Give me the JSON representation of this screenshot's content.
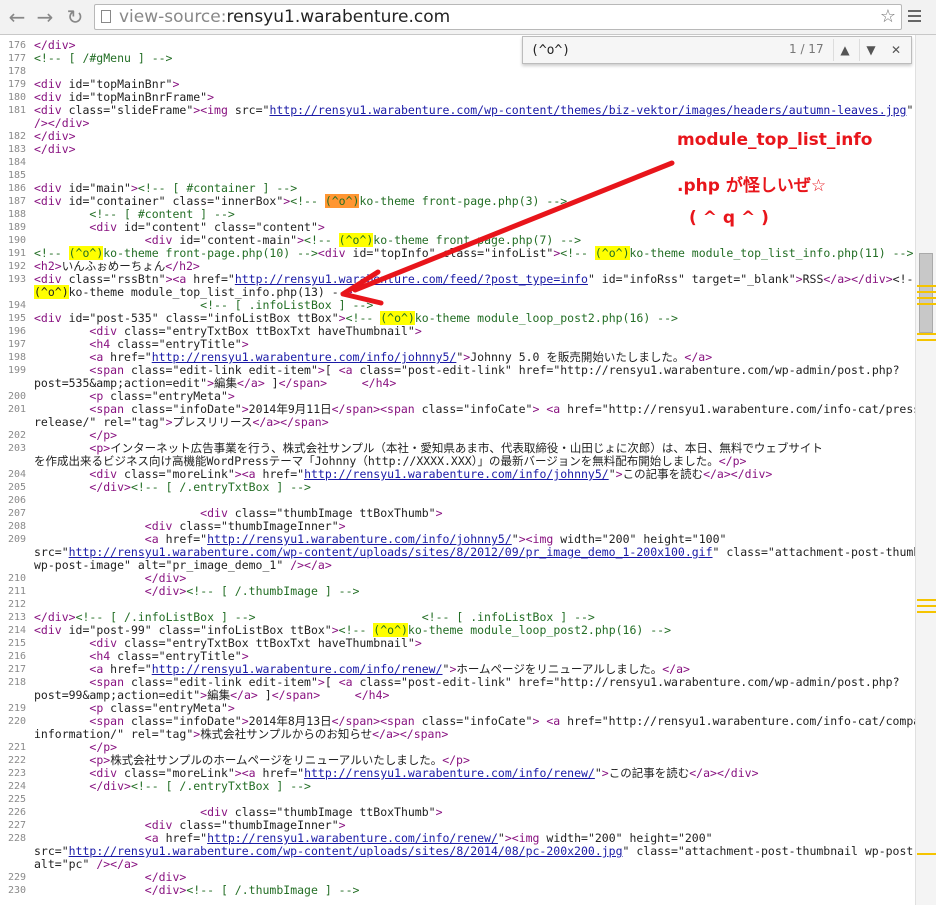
{
  "browser": {
    "url_scheme": "view-source:",
    "url_host": "rensyu1.warabenture.com"
  },
  "find_bar": {
    "query": "(^o^)",
    "count": "1 / 17"
  },
  "annotation": {
    "line1": "module_top_list_info",
    "line2": ".php が怪しいぜ☆",
    "line3": "( ^ q ^ )",
    "color": "#e8151b"
  },
  "source_lines": [
    {
      "n": "176",
      "text": "</div>"
    },
    {
      "n": "177",
      "text": "<!-- [ /#gMenu ] -->"
    },
    {
      "n": "178",
      "text": ""
    },
    {
      "n": "179",
      "text": "<div id=\"topMainBnr\">"
    },
    {
      "n": "180",
      "text": "<div id=\"topMainBnrFrame\">"
    },
    {
      "n": "181",
      "text": "<div class=\"slideFrame\"><img src=\"http://rensyu1.warabenture.com/wp-content/themes/biz-vektor/images/headers/autumn-leaves.jpg\" alt=\"\""
    },
    {
      "n": "",
      "text": "/></div>"
    },
    {
      "n": "182",
      "text": "</div>"
    },
    {
      "n": "183",
      "text": "</div>"
    },
    {
      "n": "184",
      "text": ""
    },
    {
      "n": "185",
      "text": ""
    },
    {
      "n": "186",
      "text": "<div id=\"main\"><!-- [ #container ] -->"
    },
    {
      "n": "187",
      "text": "<div id=\"container\" class=\"innerBox\"><!-- (^o^)ko-theme front-page.php(3) -->"
    },
    {
      "n": "188",
      "text": "        <!-- [ #content ] -->"
    },
    {
      "n": "189",
      "text": "        <div id=\"content\" class=\"content\">"
    },
    {
      "n": "190",
      "text": "                <div id=\"content-main\"><!-- (^o^)ko-theme front-page.php(7) -->"
    },
    {
      "n": "191",
      "text": "<!-- (^o^)ko-theme front-page.php(10) --><div id=\"topInfo\" class=\"infoList\"><!-- (^o^)ko-theme module_top_list_info.php(11) -->"
    },
    {
      "n": "192",
      "text": "<h2>いんふぉめーちょん</h2>"
    },
    {
      "n": "193",
      "text": "<div class=\"rssBtn\"><a href=\"http://rensyu1.warabenture.com/feed/?post_type=info\" id=\"infoRss\" target=\"_blank\">RSS</a></div><!--"
    },
    {
      "n": "",
      "text": "(^o^)ko-theme module_top_list_info.php(13) -->"
    },
    {
      "n": "194",
      "text": "                        <!-- [ .infoListBox ] -->"
    },
    {
      "n": "195",
      "text": "<div id=\"post-535\" class=\"infoListBox ttBox\"><!-- (^o^)ko-theme module_loop_post2.php(16) -->"
    },
    {
      "n": "196",
      "text": "        <div class=\"entryTxtBox ttBoxTxt haveThumbnail\">"
    },
    {
      "n": "197",
      "text": "        <h4 class=\"entryTitle\">"
    },
    {
      "n": "198",
      "text": "        <a href=\"http://rensyu1.warabenture.com/info/johnny5/\">Johnny 5.0 を販売開始いたしました。</a>"
    },
    {
      "n": "199",
      "text": "        <span class=\"edit-link edit-item\">[ <a class=\"post-edit-link\" href=\"http://rensyu1.warabenture.com/wp-admin/post.php?"
    },
    {
      "n": "",
      "text": "post=535&amp;action=edit\">編集</a> ]</span>     </h4>"
    },
    {
      "n": "200",
      "text": "        <p class=\"entryMeta\">"
    },
    {
      "n": "201",
      "text": "        <span class=\"infoDate\">2014年9月11日</span><span class=\"infoCate\"> <a href=\"http://rensyu1.warabenture.com/info-cat/press-"
    },
    {
      "n": "",
      "text": "release/\" rel=\"tag\">プレスリリース</a></span>"
    },
    {
      "n": "202",
      "text": "        </p>"
    },
    {
      "n": "203",
      "text": "        <p>インターネット広告事業を行う、株式会社サンプル（本社・愛知県あま市、代表取締役・山田じょに次郎）は、本日、無料でウェブサイト"
    },
    {
      "n": "",
      "text": "を作成出来るビジネス向け高機能WordPressテーマ「Johnny（http://XXXX.XXX）」の最新バージョンを無料配布開始しました。</p>"
    },
    {
      "n": "204",
      "text": "        <div class=\"moreLink\"><a href=\"http://rensyu1.warabenture.com/info/johnny5/\">この記事を読む</a></div>"
    },
    {
      "n": "205",
      "text": "        </div><!-- [ /.entryTxtBox ] -->"
    },
    {
      "n": "206",
      "text": ""
    },
    {
      "n": "207",
      "text": "                        <div class=\"thumbImage ttBoxThumb\">"
    },
    {
      "n": "208",
      "text": "                <div class=\"thumbImageInner\">"
    },
    {
      "n": "209",
      "text": "                <a href=\"http://rensyu1.warabenture.com/info/johnny5/\"><img width=\"200\" height=\"100\""
    },
    {
      "n": "",
      "text": "src=\"http://rensyu1.warabenture.com/wp-content/uploads/sites/8/2012/09/pr_image_demo_1-200x100.gif\" class=\"attachment-post-thumbnail"
    },
    {
      "n": "",
      "text": "wp-post-image\" alt=\"pr_image_demo_1\" /></a>"
    },
    {
      "n": "210",
      "text": "                </div>"
    },
    {
      "n": "211",
      "text": "                </div><!-- [ /.thumbImage ] -->"
    },
    {
      "n": "212",
      "text": ""
    },
    {
      "n": "213",
      "text": "</div><!-- [ /.infoListBox ] -->                        <!-- [ .infoListBox ] -->"
    },
    {
      "n": "214",
      "text": "<div id=\"post-99\" class=\"infoListBox ttBox\"><!-- (^o^)ko-theme module_loop_post2.php(16) -->"
    },
    {
      "n": "215",
      "text": "        <div class=\"entryTxtBox ttBoxTxt haveThumbnail\">"
    },
    {
      "n": "216",
      "text": "        <h4 class=\"entryTitle\">"
    },
    {
      "n": "217",
      "text": "        <a href=\"http://rensyu1.warabenture.com/info/renew/\">ホームページをリニューアルしました。</a>"
    },
    {
      "n": "218",
      "text": "        <span class=\"edit-link edit-item\">[ <a class=\"post-edit-link\" href=\"http://rensyu1.warabenture.com/wp-admin/post.php?"
    },
    {
      "n": "",
      "text": "post=99&amp;action=edit\">編集</a> ]</span>     </h4>"
    },
    {
      "n": "219",
      "text": "        <p class=\"entryMeta\">"
    },
    {
      "n": "220",
      "text": "        <span class=\"infoDate\">2014年8月13日</span><span class=\"infoCate\"> <a href=\"http://rensyu1.warabenture.com/info-cat/company-"
    },
    {
      "n": "",
      "text": "information/\" rel=\"tag\">株式会社サンプルからのお知らせ</a></span>"
    },
    {
      "n": "221",
      "text": "        </p>"
    },
    {
      "n": "222",
      "text": "        <p>株式会社サンプルのホームページをリニューアルいたしました。</p>"
    },
    {
      "n": "223",
      "text": "        <div class=\"moreLink\"><a href=\"http://rensyu1.warabenture.com/info/renew/\">この記事を読む</a></div>"
    },
    {
      "n": "224",
      "text": "        </div><!-- [ /.entryTxtBox ] -->"
    },
    {
      "n": "225",
      "text": ""
    },
    {
      "n": "226",
      "text": "                        <div class=\"thumbImage ttBoxThumb\">"
    },
    {
      "n": "227",
      "text": "                <div class=\"thumbImageInner\">"
    },
    {
      "n": "228",
      "text": "                <a href=\"http://rensyu1.warabenture.com/info/renew/\"><img width=\"200\" height=\"200\""
    },
    {
      "n": "",
      "text": "src=\"http://rensyu1.warabenture.com/wp-content/uploads/sites/8/2014/08/pc-200x200.jpg\" class=\"attachment-post-thumbnail wp-post-image\""
    },
    {
      "n": "",
      "text": "alt=\"pc\" /></a>"
    },
    {
      "n": "229",
      "text": "                </div>"
    },
    {
      "n": "230",
      "text": "                </div><!-- [ /.thumbImage ] -->"
    }
  ]
}
